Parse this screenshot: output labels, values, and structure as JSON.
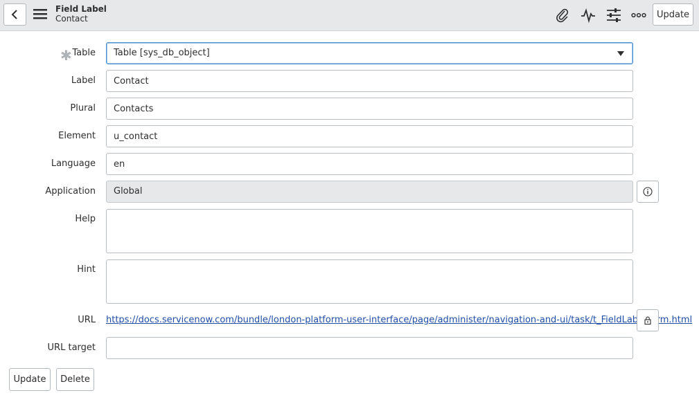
{
  "header": {
    "record_type": "Field Label",
    "record_name": "Contact",
    "update_label": "Update"
  },
  "form": {
    "table": {
      "label": "Table",
      "value": "Table [sys_db_object]"
    },
    "label": {
      "label": "Label",
      "value": "Contact"
    },
    "plural": {
      "label": "Plural",
      "value": "Contacts"
    },
    "element": {
      "label": "Element",
      "value": "u_contact"
    },
    "language": {
      "label": "Language",
      "value": "en"
    },
    "application": {
      "label": "Application",
      "value": "Global"
    },
    "help": {
      "label": "Help",
      "value": ""
    },
    "hint": {
      "label": "Hint",
      "value": ""
    },
    "url": {
      "label": "URL",
      "value": "https://docs.servicenow.com/bundle/london-platform-user-interface/page/administer/navigation-and-ui/task/t_FieldLabelForm.html"
    },
    "url_target": {
      "label": "URL target",
      "value": ""
    }
  },
  "footer": {
    "update_label": "Update",
    "delete_label": "Delete"
  },
  "icons": {
    "back": "chevron-left-icon",
    "menu": "hamburger-menu-icon",
    "attachment": "paperclip-icon",
    "activity": "pulse-icon",
    "personalize": "sliders-icon",
    "more": "ellipsis-icon",
    "info": "info-circle-icon",
    "lock": "lock-icon"
  },
  "colors": {
    "header_bg": "#e6e8ea",
    "link": "#1f4ea8",
    "focus": "#4a8fd0"
  }
}
